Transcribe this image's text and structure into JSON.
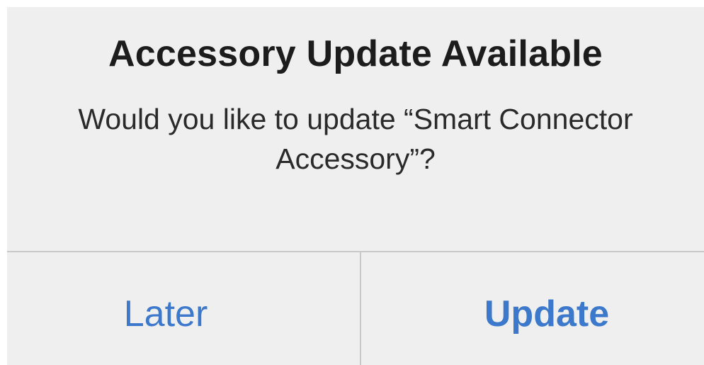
{
  "alert": {
    "title": "Accessory Update Available",
    "message": "Would you like to update “Smart Connector Accessory”?",
    "buttons": {
      "later_label": "Later",
      "update_label": "Update"
    }
  },
  "colors": {
    "background": "#efefef",
    "accent": "#3c79cc",
    "title_text": "#1c1c1c",
    "divider": "#c9c9c9"
  }
}
